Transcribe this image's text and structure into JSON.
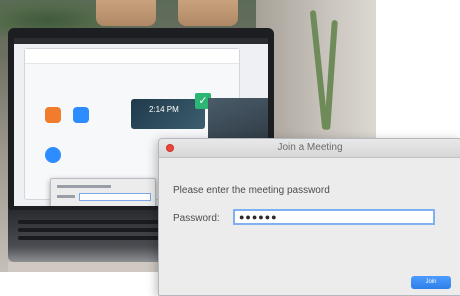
{
  "dialog": {
    "title": "Join a Meeting",
    "prompt": "Please enter the meeting password",
    "password_label": "Password:",
    "password_value": "●●●●●●",
    "join_label": "Join"
  },
  "background_laptop": {
    "clock_time": "2:14 PM"
  },
  "colors": {
    "accent_blue": "#2d8cff",
    "close_red": "#f0453b",
    "input_focus": "#7fb0f2",
    "dialog_bg": "#ececec"
  }
}
